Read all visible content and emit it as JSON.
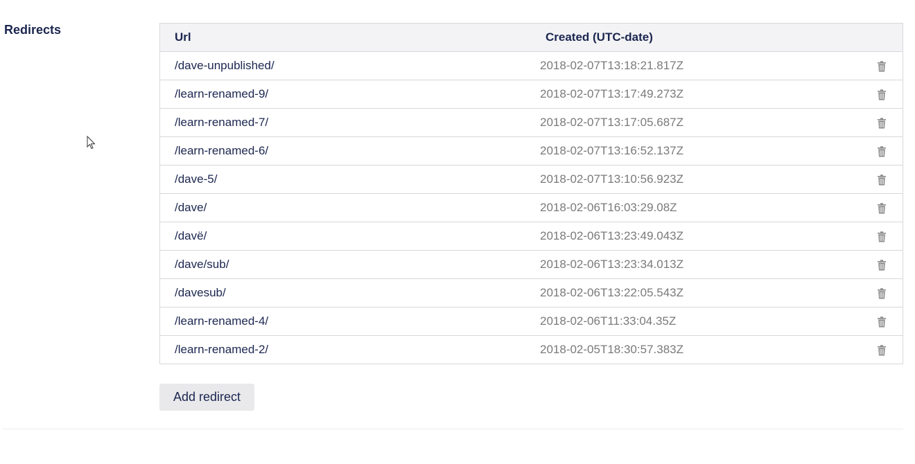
{
  "section": {
    "label": "Redirects"
  },
  "table": {
    "headers": {
      "url": "Url",
      "created": "Created (UTC-date)"
    },
    "rows": [
      {
        "url": "/dave-unpublished/",
        "created": "2018-02-07T13:18:21.817Z"
      },
      {
        "url": "/learn-renamed-9/",
        "created": "2018-02-07T13:17:49.273Z"
      },
      {
        "url": "/learn-renamed-7/",
        "created": "2018-02-07T13:17:05.687Z"
      },
      {
        "url": "/learn-renamed-6/",
        "created": "2018-02-07T13:16:52.137Z"
      },
      {
        "url": "/dave-5/",
        "created": "2018-02-07T13:10:56.923Z"
      },
      {
        "url": "/dave/",
        "created": "2018-02-06T16:03:29.08Z"
      },
      {
        "url": "/davë/",
        "created": "2018-02-06T13:23:49.043Z"
      },
      {
        "url": "/dave/sub/",
        "created": "2018-02-06T13:23:34.013Z"
      },
      {
        "url": "/davesub/",
        "created": "2018-02-06T13:22:05.543Z"
      },
      {
        "url": "/learn-renamed-4/",
        "created": "2018-02-06T11:33:04.35Z"
      },
      {
        "url": "/learn-renamed-2/",
        "created": "2018-02-05T18:30:57.383Z"
      }
    ],
    "row_action_icon": "trash-icon"
  },
  "actions": {
    "add_label": "Add redirect"
  },
  "colors": {
    "text": "#1b264f",
    "muted": "#7a7a7a",
    "border": "#d8d7d9",
    "header_bg": "#f3f3f5",
    "button_bg": "#e9e9eb"
  }
}
